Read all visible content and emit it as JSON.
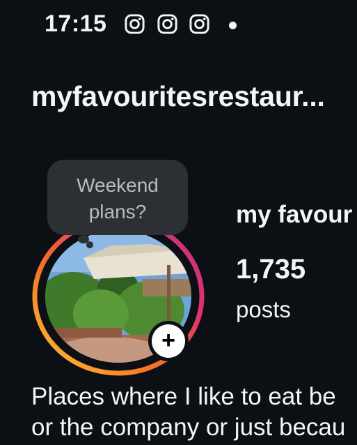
{
  "status_bar": {
    "time": "17:15",
    "notification_icons": [
      "instagram-icon",
      "instagram-icon",
      "instagram-icon"
    ],
    "more_indicator": "dot"
  },
  "profile": {
    "username": "myfavouritesrestaur...",
    "note": "Weekend plans?",
    "display_name": "my favour",
    "posts_count": "1,735",
    "posts_label": "posts",
    "bio_lines": [
      "Places where I like to eat be",
      "or the company or just becau"
    ],
    "story_ring_colors": [
      "#fec43a",
      "#f77624",
      "#e1306c",
      "#c13584"
    ],
    "add_story_symbol": "+"
  }
}
